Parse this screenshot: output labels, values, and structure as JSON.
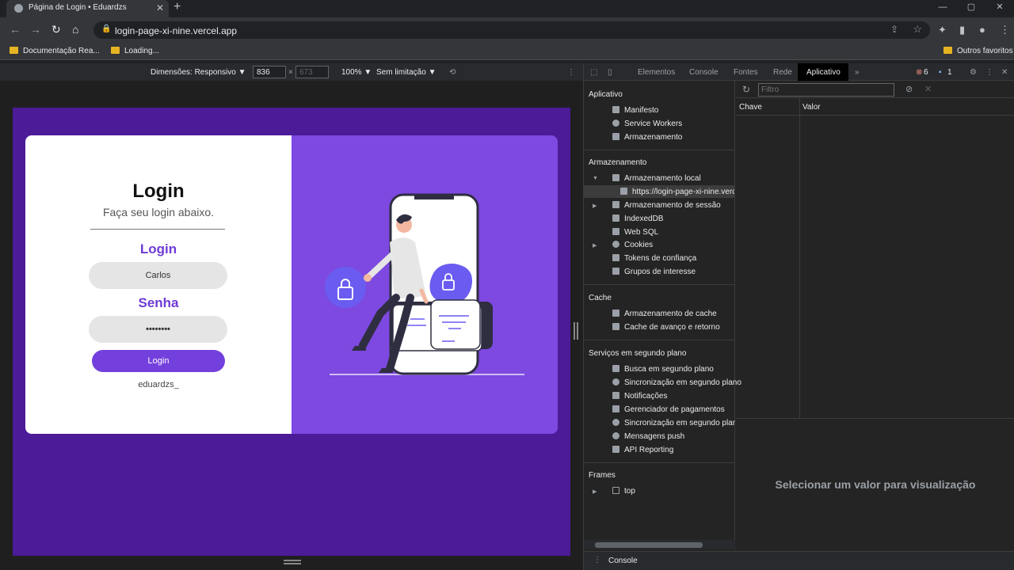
{
  "browser": {
    "tab_title": "Página de Login • Eduardzs",
    "tab_close": "✕",
    "new_tab": "+",
    "url": "login-page-xi-nine.vercel.app",
    "bookmarks": [
      "Documentação Rea...",
      "Loading..."
    ],
    "other_favorites": "Outros favoritos",
    "window_controls": [
      "—",
      "▢",
      "✕"
    ]
  },
  "device_toolbar": {
    "dimensions_label": "Dimensões: Responsivo ▼",
    "width": "836",
    "height": "673",
    "times": "×",
    "zoom": "100% ▼",
    "throttle": "Sem limitação ▼"
  },
  "login_page": {
    "title": "Login",
    "subtitle": "Faça seu login abaixo.",
    "login_label": "Login",
    "login_value": "Carlos",
    "password_label": "Senha",
    "password_value": "••••••••",
    "button_label": "Login",
    "author": "eduardzs_",
    "accent_color": "#7440dd",
    "background_color": "#4b1b98"
  },
  "devtools": {
    "tabs": [
      "Elementos",
      "Console",
      "Fontes",
      "Rede",
      "Aplicativo"
    ],
    "more_tabs": "»",
    "errors": "6",
    "messages": "1",
    "active_tab": "Aplicativo",
    "sections": {
      "app": "Aplicativo",
      "storage": "Armazenamento",
      "cache": "Cache",
      "background": "Serviços em segundo plano",
      "frames": "Frames"
    },
    "app_items": [
      "Manifesto",
      "Service Workers",
      "Armazenamento"
    ],
    "storage_items": [
      "Armazenamento local",
      "https://login-page-xi-nine.vercel.app",
      "Armazenamento de sessão",
      "IndexedDB",
      "Web SQL",
      "Cookies",
      "Tokens de confiança",
      "Grupos de interesse"
    ],
    "cache_items": [
      "Armazenamento de cache",
      "Cache de avanço e retorno"
    ],
    "background_items": [
      "Busca em segundo plano",
      "Sincronização em segundo plano",
      "Notificações",
      "Gerenciador de pagamentos",
      "Sincronização em segundo plano periódica",
      "Mensagens push",
      "API Reporting"
    ],
    "frames_items": [
      "top"
    ],
    "filter_placeholder": "Filtro",
    "col_key": "Chave",
    "col_value": "Valor",
    "preview_text": "Selecionar um valor para visualização",
    "console_label": "Console"
  }
}
